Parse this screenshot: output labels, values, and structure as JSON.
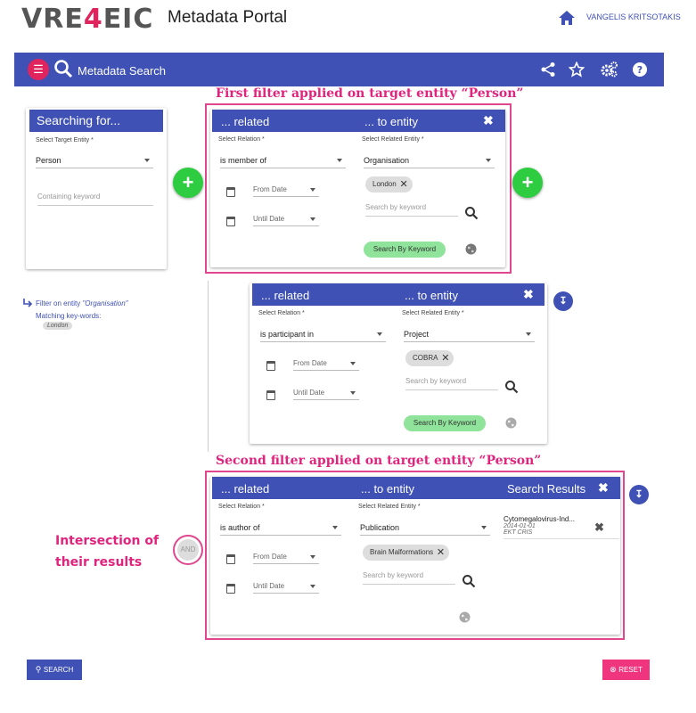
{
  "header": {
    "logo_a": "VRE",
    "logo_b": "4",
    "logo_c": "EIC",
    "title": "Metadata Portal",
    "user": "VANGELIS KRITSOTAKIS"
  },
  "toolbar": {
    "title": "Metadata Search"
  },
  "annotations": {
    "first": "First filter applied on target entity “Person”",
    "second": "Second filter applied on target entity “Person”",
    "intersection_line1": "Intersection of",
    "intersection_line2": "their results"
  },
  "searching": {
    "head": "Searching for...",
    "label": "Select Target Entity *",
    "value": "Person",
    "keyword_placeholder": "Containing keyword"
  },
  "side_filter": {
    "prefix": "Filter on entity ",
    "entity": "\"Organisation\"",
    "matching": "Matching key-words:",
    "chip": "London"
  },
  "filter1": {
    "head_related": "... related",
    "head_entity": "... to entity",
    "relation_label": "Select Relation *",
    "relation": "is member of",
    "entity_label": "Select Related Entity *",
    "entity": "Organisation",
    "chip": "London",
    "from": "From Date",
    "until": "Until Date",
    "keyword_placeholder": "Search by keyword",
    "keyword_btn": "Search By Keyword"
  },
  "filter_nested": {
    "head_related": "... related",
    "head_entity": "... to entity",
    "relation_label": "Select Relation *",
    "relation": "is participant in",
    "entity_label": "Select Related Entity *",
    "entity": "Project",
    "chip": "COBRA",
    "from": "From Date",
    "until": "Until Date",
    "keyword_placeholder": "Search by keyword",
    "keyword_btn": "Search By Keyword"
  },
  "filter2": {
    "head_related": "... related",
    "head_entity": "... to entity",
    "head_results": "Search Results",
    "relation_label": "Select Relation *",
    "relation": "is author of",
    "entity_label": "Select Related Entity *",
    "entity": "Publication",
    "chip": "Brain Malformations",
    "from": "From Date",
    "until": "Until Date",
    "keyword_placeholder": "Search by keyword",
    "result_title": "Cytomegalovirus-Ind...",
    "result_date": "2014-01-01",
    "result_source": "EKT CRIS"
  },
  "and_label": "AND",
  "buttons": {
    "search": "SEARCH",
    "reset": "RESET"
  },
  "colors": {
    "primary": "#3f51b5",
    "accent": "#e0245e",
    "annotation": "#e0247e",
    "green": "#2ecc40"
  },
  "icons": [
    "home-icon",
    "menu-icon",
    "search-icon",
    "share-icon",
    "star-icon",
    "settings-icon",
    "help-icon",
    "calendar-icon",
    "globe-icon",
    "close-icon",
    "plus-icon",
    "arrow-down-icon"
  ]
}
